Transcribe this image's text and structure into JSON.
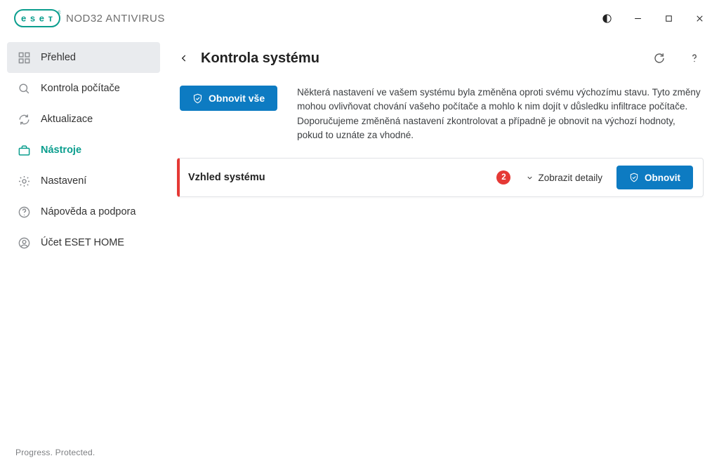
{
  "titlebar": {
    "product": "NOD32 ANTIVIRUS"
  },
  "sidebar": {
    "items": [
      {
        "label": "Přehled"
      },
      {
        "label": "Kontrola počítače"
      },
      {
        "label": "Aktualizace"
      },
      {
        "label": "Nástroje"
      },
      {
        "label": "Nastavení"
      },
      {
        "label": "Nápověda a podpora"
      },
      {
        "label": "Účet ESET HOME"
      }
    ],
    "tagline": "Progress. Protected."
  },
  "page": {
    "title": "Kontrola systému",
    "restore_all": "Obnovit vše",
    "intro": "Některá nastavení ve vašem systému byla změněna oproti svému výchozímu stavu. Tyto změny mohou ovlivňovat chování vašeho počítače a mohlo k nim dojít v důsledku infiltrace počítače. Doporučujeme změněná nastavení zkontrolovat a případně je obnovit na výchozí hodnoty, pokud to uznáte za vhodné."
  },
  "card": {
    "title": "Vzhled systému",
    "count": "2",
    "details": "Zobrazit detaily",
    "restore": "Obnovit"
  }
}
